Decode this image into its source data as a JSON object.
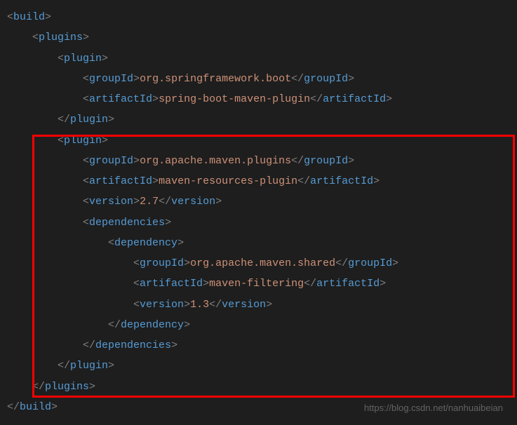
{
  "code": {
    "lines": [
      {
        "indent": 0,
        "parts": [
          {
            "t": "tag",
            "v": "<"
          },
          {
            "t": "name",
            "v": "build"
          },
          {
            "t": "tag",
            "v": ">"
          }
        ]
      },
      {
        "indent": 1,
        "parts": [
          {
            "t": "tag",
            "v": "<"
          },
          {
            "t": "name",
            "v": "plugins"
          },
          {
            "t": "tag",
            "v": ">"
          }
        ]
      },
      {
        "indent": 2,
        "parts": [
          {
            "t": "tag",
            "v": "<"
          },
          {
            "t": "name",
            "v": "plugin"
          },
          {
            "t": "tag",
            "v": ">"
          }
        ]
      },
      {
        "indent": 3,
        "parts": [
          {
            "t": "tag",
            "v": "<"
          },
          {
            "t": "name",
            "v": "groupId"
          },
          {
            "t": "tag",
            "v": ">"
          },
          {
            "t": "text",
            "v": "org.springframework.boot"
          },
          {
            "t": "tag",
            "v": "</"
          },
          {
            "t": "name",
            "v": "groupId"
          },
          {
            "t": "tag",
            "v": ">"
          }
        ]
      },
      {
        "indent": 3,
        "parts": [
          {
            "t": "tag",
            "v": "<"
          },
          {
            "t": "name",
            "v": "artifactId"
          },
          {
            "t": "tag",
            "v": ">"
          },
          {
            "t": "text",
            "v": "spring-boot-maven-plugin"
          },
          {
            "t": "tag",
            "v": "</"
          },
          {
            "t": "name",
            "v": "artifactId"
          },
          {
            "t": "tag",
            "v": ">"
          }
        ]
      },
      {
        "indent": 2,
        "parts": [
          {
            "t": "tag",
            "v": "</"
          },
          {
            "t": "name",
            "v": "plugin"
          },
          {
            "t": "tag",
            "v": ">"
          }
        ]
      },
      {
        "indent": 2,
        "parts": [
          {
            "t": "tag",
            "v": "<"
          },
          {
            "t": "name",
            "v": "plugin"
          },
          {
            "t": "tag",
            "v": ">"
          }
        ]
      },
      {
        "indent": 3,
        "parts": [
          {
            "t": "tag",
            "v": "<"
          },
          {
            "t": "name",
            "v": "groupId"
          },
          {
            "t": "tag",
            "v": ">"
          },
          {
            "t": "text",
            "v": "org.apache.maven.plugins"
          },
          {
            "t": "tag",
            "v": "</"
          },
          {
            "t": "name",
            "v": "groupId"
          },
          {
            "t": "tag",
            "v": ">"
          }
        ]
      },
      {
        "indent": 3,
        "parts": [
          {
            "t": "tag",
            "v": "<"
          },
          {
            "t": "name",
            "v": "artifactId"
          },
          {
            "t": "tag",
            "v": ">"
          },
          {
            "t": "text",
            "v": "maven-resources-plugin"
          },
          {
            "t": "tag",
            "v": "</"
          },
          {
            "t": "name",
            "v": "artifactId"
          },
          {
            "t": "tag",
            "v": ">"
          }
        ]
      },
      {
        "indent": 3,
        "parts": [
          {
            "t": "tag",
            "v": "<"
          },
          {
            "t": "name",
            "v": "version"
          },
          {
            "t": "tag",
            "v": ">"
          },
          {
            "t": "text",
            "v": "2.7"
          },
          {
            "t": "tag",
            "v": "</"
          },
          {
            "t": "name",
            "v": "version"
          },
          {
            "t": "tag",
            "v": ">"
          }
        ]
      },
      {
        "indent": 3,
        "parts": [
          {
            "t": "tag",
            "v": "<"
          },
          {
            "t": "name",
            "v": "dependencies"
          },
          {
            "t": "tag",
            "v": ">"
          }
        ]
      },
      {
        "indent": 4,
        "parts": [
          {
            "t": "tag",
            "v": "<"
          },
          {
            "t": "name",
            "v": "dependency"
          },
          {
            "t": "tag",
            "v": ">"
          }
        ]
      },
      {
        "indent": 5,
        "parts": [
          {
            "t": "tag",
            "v": "<"
          },
          {
            "t": "name",
            "v": "groupId"
          },
          {
            "t": "tag",
            "v": ">"
          },
          {
            "t": "text",
            "v": "org.apache.maven.shared"
          },
          {
            "t": "tag",
            "v": "</"
          },
          {
            "t": "name",
            "v": "groupId"
          },
          {
            "t": "tag",
            "v": ">"
          }
        ]
      },
      {
        "indent": 5,
        "parts": [
          {
            "t": "tag",
            "v": "<"
          },
          {
            "t": "name",
            "v": "artifactId"
          },
          {
            "t": "tag",
            "v": ">"
          },
          {
            "t": "text",
            "v": "maven-filtering"
          },
          {
            "t": "tag",
            "v": "</"
          },
          {
            "t": "name",
            "v": "artifactId"
          },
          {
            "t": "tag",
            "v": ">"
          }
        ]
      },
      {
        "indent": 5,
        "parts": [
          {
            "t": "tag",
            "v": "<"
          },
          {
            "t": "name",
            "v": "version"
          },
          {
            "t": "tag",
            "v": ">"
          },
          {
            "t": "text",
            "v": "1.3"
          },
          {
            "t": "tag",
            "v": "</"
          },
          {
            "t": "name",
            "v": "version"
          },
          {
            "t": "tag",
            "v": ">"
          }
        ]
      },
      {
        "indent": 4,
        "parts": [
          {
            "t": "tag",
            "v": "</"
          },
          {
            "t": "name",
            "v": "dependency"
          },
          {
            "t": "tag",
            "v": ">"
          }
        ]
      },
      {
        "indent": 3,
        "parts": [
          {
            "t": "tag",
            "v": "</"
          },
          {
            "t": "name",
            "v": "dependencies"
          },
          {
            "t": "tag",
            "v": ">"
          }
        ]
      },
      {
        "indent": 2,
        "parts": [
          {
            "t": "tag",
            "v": "</"
          },
          {
            "t": "name",
            "v": "plugin"
          },
          {
            "t": "tag",
            "v": ">"
          }
        ]
      },
      {
        "indent": 1,
        "parts": [
          {
            "t": "tag",
            "v": "</"
          },
          {
            "t": "name",
            "v": "plugins"
          },
          {
            "t": "tag",
            "v": ">"
          }
        ]
      },
      {
        "indent": 0,
        "parts": [
          {
            "t": "tag",
            "v": "</"
          },
          {
            "t": "name",
            "v": "build"
          },
          {
            "t": "tag",
            "v": ">"
          }
        ]
      }
    ]
  },
  "watermark": "https://blog.csdn.net/nanhuaibeian",
  "indent_unit": "    "
}
